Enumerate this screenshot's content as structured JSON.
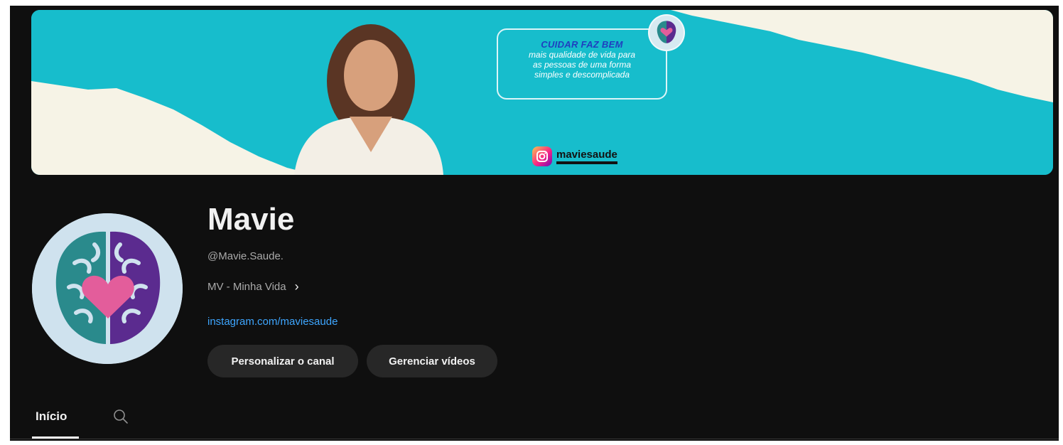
{
  "banner": {
    "promo_title": "CUIDAR FAZ BEM",
    "promo_lines": [
      "mais qualidade de vida para",
      "as pessoas de uma forma",
      "simples e descomplicada"
    ],
    "instagram_handle": "maviesaude",
    "accent_color": "#16bccb"
  },
  "channel": {
    "name": "Mavie",
    "handle": "@Mavie.Saude.",
    "description": "MV - Minha Vida",
    "link": "instagram.com/maviesaude"
  },
  "buttons": {
    "customize": "Personalizar o canal",
    "manage": "Gerenciar vídeos"
  },
  "tabs": {
    "home": "Início",
    "search_icon": "search-icon"
  }
}
